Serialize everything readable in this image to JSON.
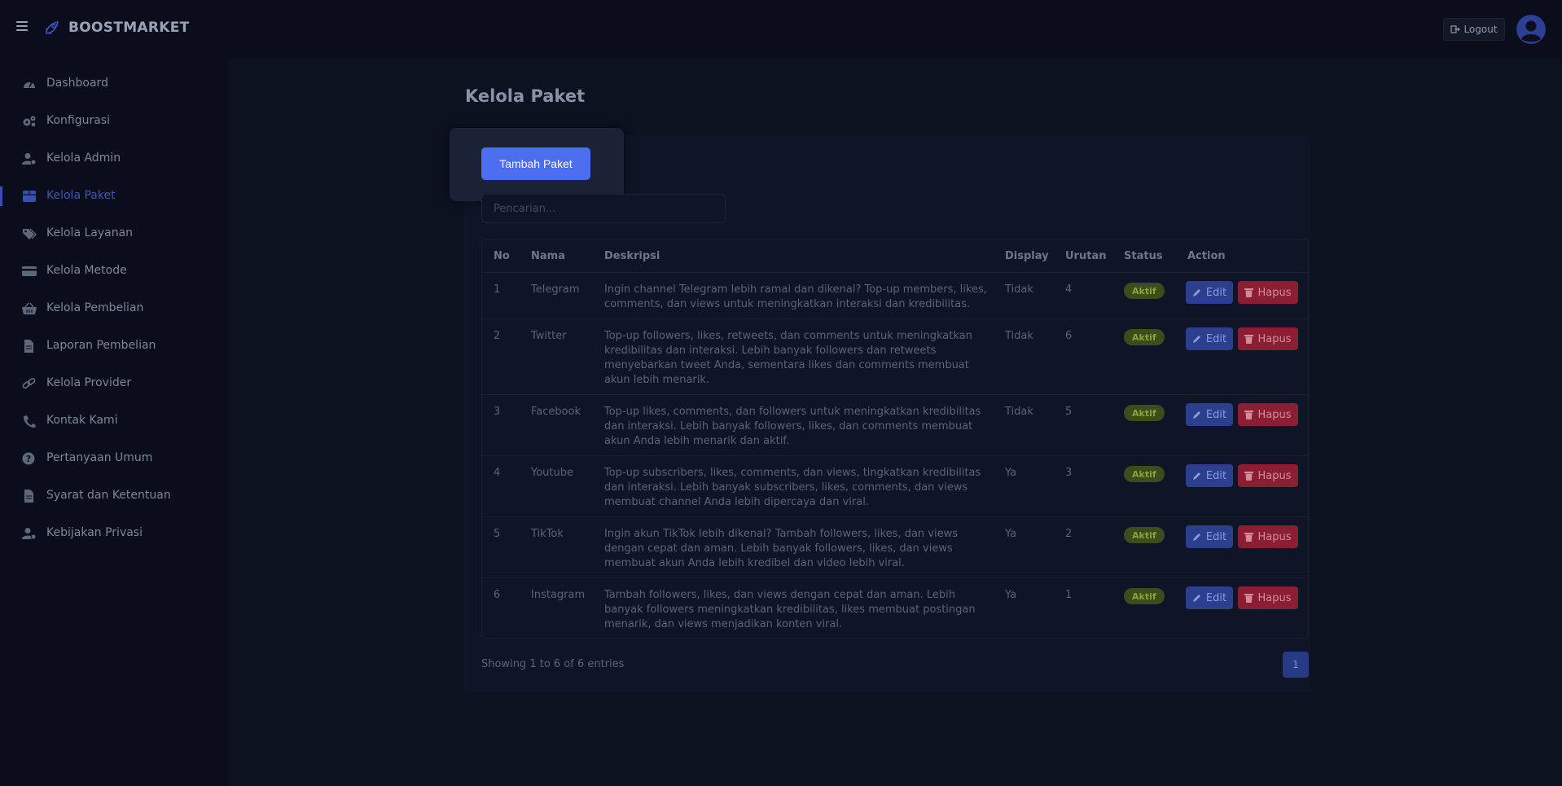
{
  "brand": {
    "name": "BOOSTMARKET"
  },
  "topbar": {
    "logout_label": "Logout"
  },
  "sidebar": {
    "items": [
      {
        "label": "Dashboard",
        "icon": "gauge-icon"
      },
      {
        "label": "Konfigurasi",
        "icon": "gears-icon"
      },
      {
        "label": "Kelola Admin",
        "icon": "user-gear-icon"
      },
      {
        "label": "Kelola Paket",
        "icon": "box-icon",
        "active": true
      },
      {
        "label": "Kelola Layanan",
        "icon": "tags-icon"
      },
      {
        "label": "Kelola Metode",
        "icon": "credit-card-icon"
      },
      {
        "label": "Kelola Pembelian",
        "icon": "basket-icon"
      },
      {
        "label": "Laporan Pembelian",
        "icon": "file-icon"
      },
      {
        "label": "Kelola Provider",
        "icon": "link-icon"
      },
      {
        "label": "Kontak Kami",
        "icon": "phone-icon"
      },
      {
        "label": "Pertanyaan Umum",
        "icon": "question-icon"
      },
      {
        "label": "Syarat dan Ketentuan",
        "icon": "file-icon"
      },
      {
        "label": "Kebijakan Privasi",
        "icon": "user-gear-icon"
      }
    ]
  },
  "main": {
    "title": "Kelola Paket",
    "add_button": "Tambah Paket",
    "search_placeholder": "Pencarian...",
    "table": {
      "headers": [
        "No",
        "Nama",
        "Deskripsi",
        "Display",
        "Urutan",
        "Status",
        "Action"
      ],
      "rows": [
        {
          "no": "1",
          "nama": "Telegram",
          "deskripsi": "Ingin channel Telegram lebih ramai dan dikenal? Top-up members, likes, comments, dan views untuk meningkatkan interaksi dan kredibilitas.",
          "display": "Tidak",
          "urutan": "4",
          "status": "Aktif"
        },
        {
          "no": "2",
          "nama": "Twitter",
          "deskripsi": "Top-up followers, likes, retweets, dan comments untuk meningkatkan kredibilitas dan interaksi. Lebih banyak followers dan retweets menyebarkan tweet Anda, sementara likes dan comments membuat akun lebih menarik.",
          "display": "Tidak",
          "urutan": "6",
          "status": "Aktif"
        },
        {
          "no": "3",
          "nama": "Facebook",
          "deskripsi": "Top-up likes, comments, dan followers untuk meningkatkan kredibilitas dan interaksi. Lebih banyak followers, likes, dan comments membuat akun Anda lebih menarik dan aktif.",
          "display": "Tidak",
          "urutan": "5",
          "status": "Aktif"
        },
        {
          "no": "4",
          "nama": "Youtube",
          "deskripsi": "Top-up subscribers, likes, comments, dan views, tingkatkan kredibilitas dan interaksi. Lebih banyak subscribers, likes, comments, dan views membuat channel Anda lebih dipercaya dan viral.",
          "display": "Ya",
          "urutan": "3",
          "status": "Aktif"
        },
        {
          "no": "5",
          "nama": "TikTok",
          "deskripsi": "Ingin akun TikTok lebih dikenal? Tambah followers, likes, dan views dengan cepat dan aman. Lebih banyak followers, likes, dan views membuat akun Anda lebih kredibel dan video lebih viral.",
          "display": "Ya",
          "urutan": "2",
          "status": "Aktif"
        },
        {
          "no": "6",
          "nama": "Instagram",
          "deskripsi": "Tambah followers, likes, dan views dengan cepat dan aman. Lebih banyak followers meningkatkan kredibilitas, likes membuat postingan menarik, dan views menjadikan konten viral.",
          "display": "Ya",
          "urutan": "1",
          "status": "Aktif"
        }
      ],
      "edit_label": "Edit",
      "delete_label": "Hapus"
    },
    "showing_text": "Showing 1 to 6 of 6 entries",
    "pagination": [
      "1"
    ]
  },
  "colors": {
    "accent": "#4b6ef0",
    "badge_active": "#3a4d1a",
    "delete": "#8a1f34"
  }
}
